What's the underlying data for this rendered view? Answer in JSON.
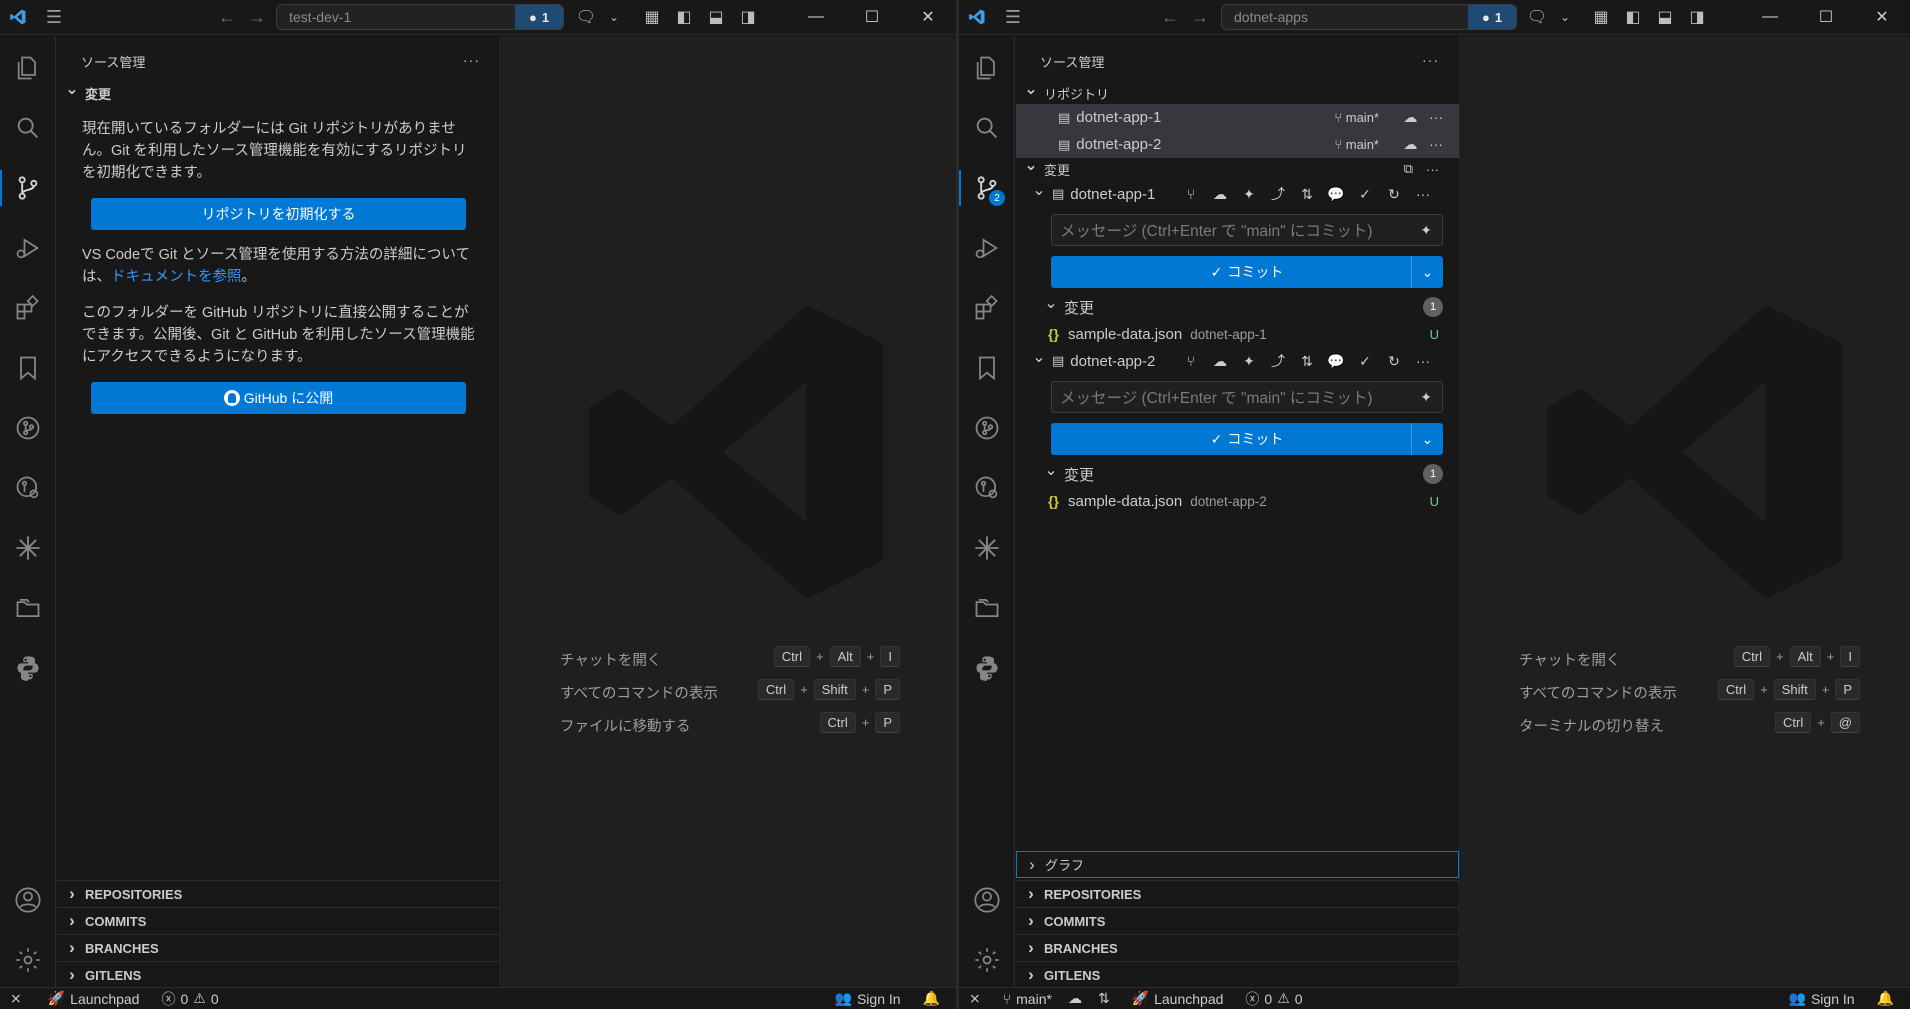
{
  "left": {
    "title_search": "test-dev-1",
    "notif_count": "1",
    "sidebar_title": "ソース管理",
    "changes_label": "変更",
    "para1": "現在開いているフォルダーには Git リポジトリがありません。Git を利用したソース管理機能を有効にするリポジトリを初期化できます。",
    "init_button": "リポジトリを初期化する",
    "para2_pre": "VS Codeで Git とソース管理を使用する方法の詳細については、",
    "para2_link": "ドキュメントを参照",
    "para2_post": "。",
    "para3": "このフォルダーを GitHub リポジトリに直接公開することができます。公開後、Git と GitHub を利用したソース管理機能にアクセスできるようになります。",
    "publish_button": "GitHub に公開",
    "sections": [
      "REPOSITORIES",
      "COMMITS",
      "BRANCHES",
      "GITLENS"
    ],
    "shortcuts": [
      {
        "label": "チャットを開く",
        "keys": [
          "Ctrl",
          "Alt",
          "I"
        ]
      },
      {
        "label": "すべてのコマンドの表示",
        "keys": [
          "Ctrl",
          "Shift",
          "P"
        ]
      },
      {
        "label": "ファイルに移動する",
        "keys": [
          "Ctrl",
          "P"
        ]
      }
    ],
    "status": {
      "launchpad": "Launchpad",
      "errors": "0",
      "warnings": "0",
      "signin": "Sign In"
    }
  },
  "right": {
    "title_search": "dotnet-apps",
    "notif_count": "1",
    "scm_badge": "2",
    "sidebar_title": "ソース管理",
    "repos_label": "リポジトリ",
    "repos": [
      {
        "name": "dotnet-app-1",
        "branch": "main*"
      },
      {
        "name": "dotnet-app-2",
        "branch": "main*"
      }
    ],
    "changes_label": "変更",
    "groups": [
      {
        "repo": "dotnet-app-1",
        "placeholder": "メッセージ (Ctrl+Enter で \"main\" にコミット)",
        "commit": "コミット",
        "changes": "変更",
        "count": "1",
        "file": "sample-data.json",
        "file_desc": "dotnet-app-1",
        "status": "U"
      },
      {
        "repo": "dotnet-app-2",
        "placeholder": "メッセージ (Ctrl+Enter で \"main\" にコミット)",
        "commit": "コミット",
        "changes": "変更",
        "count": "1",
        "file": "sample-data.json",
        "file_desc": "dotnet-app-2",
        "status": "U"
      }
    ],
    "graph_label": "グラフ",
    "sections": [
      "REPOSITORIES",
      "COMMITS",
      "BRANCHES",
      "GITLENS"
    ],
    "shortcuts": [
      {
        "label": "チャットを開く",
        "keys": [
          "Ctrl",
          "Alt",
          "I"
        ]
      },
      {
        "label": "すべてのコマンドの表示",
        "keys": [
          "Ctrl",
          "Shift",
          "P"
        ]
      },
      {
        "label": "ターミナルの切り替え",
        "keys": [
          "Ctrl",
          "@"
        ]
      }
    ],
    "status": {
      "branch": "main*",
      "launchpad": "Launchpad",
      "errors": "0",
      "warnings": "0",
      "signin": "Sign In"
    }
  },
  "colors": {
    "accent": "#0078d4",
    "link": "#3794ff",
    "untracked": "#73c991"
  }
}
